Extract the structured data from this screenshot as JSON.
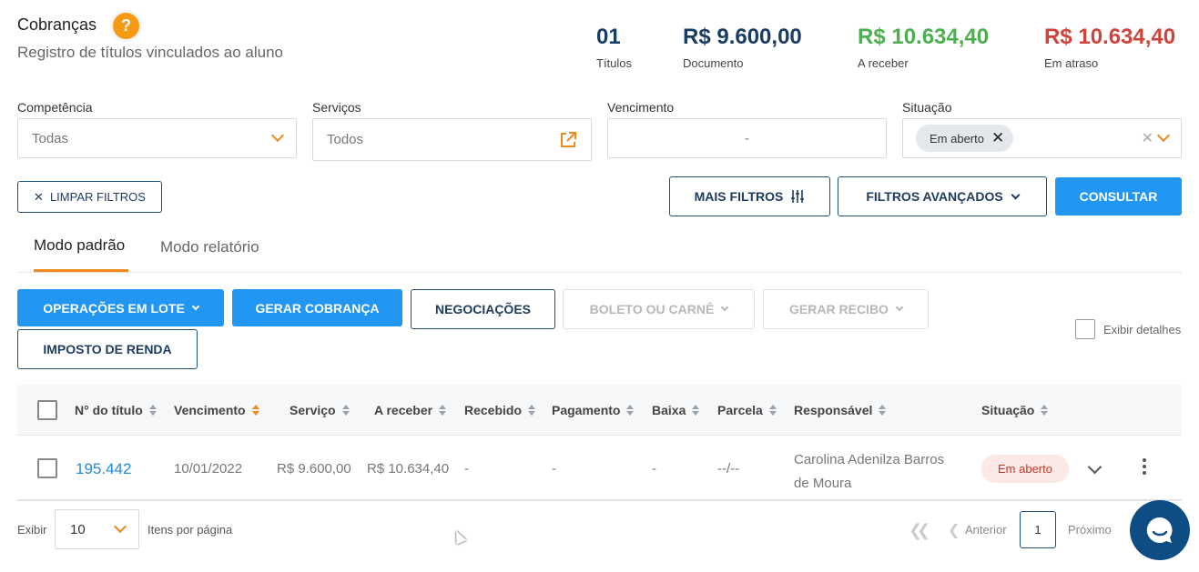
{
  "header": {
    "title": "Cobranças",
    "help_icon": "?",
    "subtitle": "Registro de títulos vinculados ao aluno"
  },
  "stats": [
    {
      "value": "01",
      "label": "Títulos",
      "color": "#1a3d63"
    },
    {
      "value": "R$ 9.600,00",
      "label": "Documento",
      "color": "#1a3d63"
    },
    {
      "value": "R$ 10.634,40",
      "label": "A receber",
      "color": "#4caf50"
    },
    {
      "value": "R$ 10.634,40",
      "label": "Em atraso",
      "color": "#d0433a"
    }
  ],
  "filters": {
    "competencia": {
      "label": "Competência",
      "value": "Todas"
    },
    "servicos": {
      "label": "Serviços",
      "placeholder": "Todos"
    },
    "vencimento": {
      "label": "Vencimento",
      "value": "-"
    },
    "situacao": {
      "label": "Situação",
      "chip": "Em aberto",
      "clear": "✕"
    }
  },
  "buttons": {
    "limpar": "LIMPAR FILTROS",
    "mais_filtros": "MAIS FILTROS",
    "filtros_avancados": "FILTROS AVANÇADOS",
    "consultar": "CONSULTAR",
    "operacoes_lote": "OPERAÇÕES EM LOTE",
    "gerar_cobranca": "GERAR COBRANÇA",
    "negociacoes": "NEGOCIAÇÕES",
    "boleto_carne": "BOLETO OU CARNÊ",
    "gerar_recibo": "GERAR RECIBO",
    "imposto_renda": "IMPOSTO DE RENDA"
  },
  "tabs": [
    {
      "label": "Modo padrão",
      "active": true
    },
    {
      "label": "Modo relatório",
      "active": false
    }
  ],
  "exibir_detalhes": "Exibir detalhes",
  "table": {
    "columns": [
      "N° do título",
      "Vencimento",
      "Serviço",
      "A receber",
      "Recebido",
      "Pagamento",
      "Baixa",
      "Parcela",
      "Responsável",
      "Situação"
    ],
    "rows": [
      {
        "numero": "195.442",
        "vencimento": "10/01/2022",
        "servico": "R$ 9.600,00",
        "a_receber": "R$ 10.634,40",
        "recebido": "-",
        "pagamento": "-",
        "baixa": "-",
        "parcela": "--/--",
        "responsavel_line1": "Carolina Adenilza Barros",
        "responsavel_line2": "de Moura",
        "situacao": "Em aberto"
      }
    ]
  },
  "pagination": {
    "exibir": "Exibir",
    "per_page": "10",
    "itens_por_pagina": "Itens por página",
    "anterior": "Anterior",
    "current_page": "1",
    "proximo": "Próximo"
  }
}
